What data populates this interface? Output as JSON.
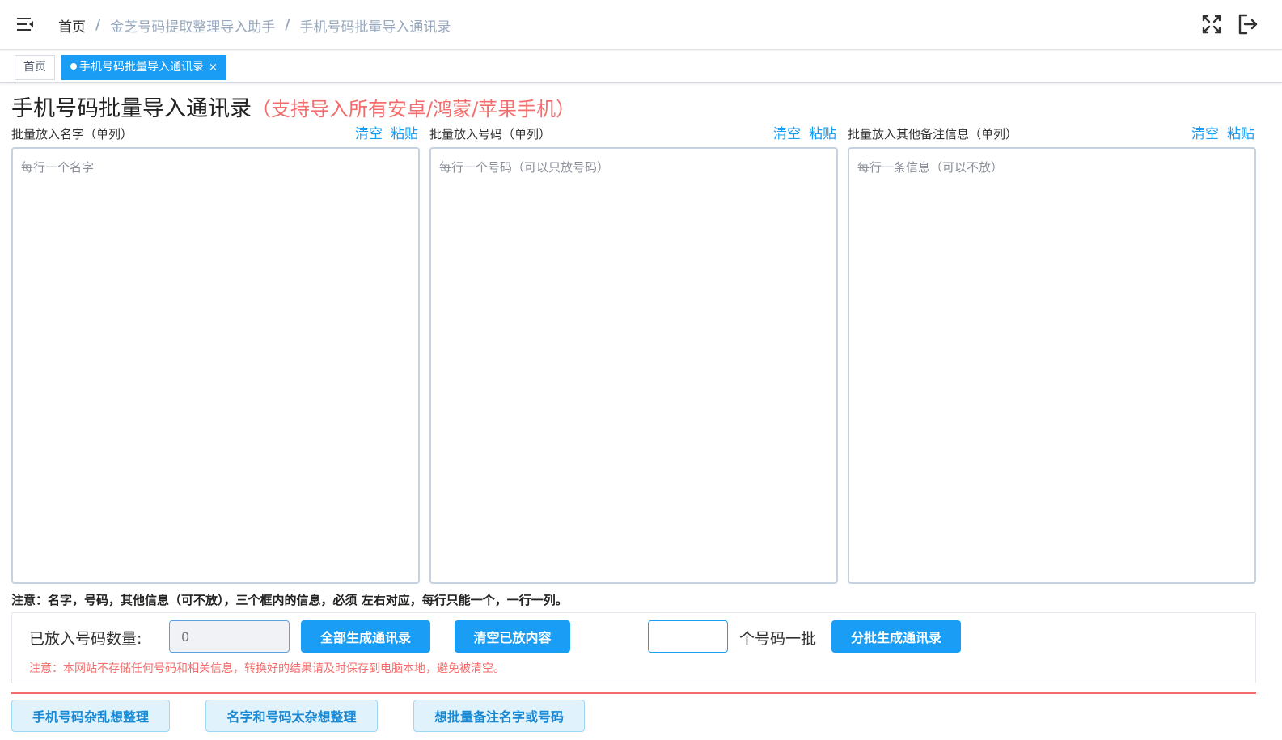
{
  "breadcrumb": {
    "home": "首页",
    "level2": "金芝号码提取整理导入助手",
    "level3": "手机号码批量导入通讯录",
    "separator": "/"
  },
  "tags": {
    "home": "首页",
    "active": "手机号码批量导入通讯录",
    "close": "×"
  },
  "title": {
    "main": "手机号码批量导入通讯录",
    "sub": "（支持导入所有安卓/鸿蒙/苹果手机）"
  },
  "columns": [
    {
      "label": "批量放入名字（单列）",
      "clear": "清空",
      "paste": "粘贴",
      "placeholder": "每行一个名字"
    },
    {
      "label": "批量放入号码（单列）",
      "clear": "清空",
      "paste": "粘贴",
      "placeholder": "每行一个号码（可以只放号码）"
    },
    {
      "label": "批量放入其他备注信息（单列）",
      "clear": "清空",
      "paste": "粘贴",
      "placeholder": "每行一条信息（可以不放）"
    }
  ],
  "notice": "注意：名字，号码，其他信息（可不放），三个框内的信息，必须 左右对应，每行只能一个，一行一列。",
  "panel": {
    "count_label": "已放入号码数量:",
    "count_value": "0",
    "generate_all": "全部生成通讯录",
    "clear_all": "清空已放内容",
    "batch_label": "个号码一批",
    "generate_batch": "分批生成通讯录",
    "warning": "注意：本网站不存储任何号码和相关信息，转换好的结果请及时保存到电脑本地，避免被清空。"
  },
  "bottom_buttons": {
    "b1": "手机号码杂乱想整理",
    "b2": "名字和号码太杂想整理",
    "b3": "想批量备注名字或号码"
  },
  "colors": {
    "primary": "#1a9df4",
    "danger": "#f56c6c",
    "muted": "#97a8be"
  },
  "icons": {
    "menu": "hamburger-icon",
    "fullscreen": "fullscreen-icon",
    "logout": "logout-icon"
  }
}
